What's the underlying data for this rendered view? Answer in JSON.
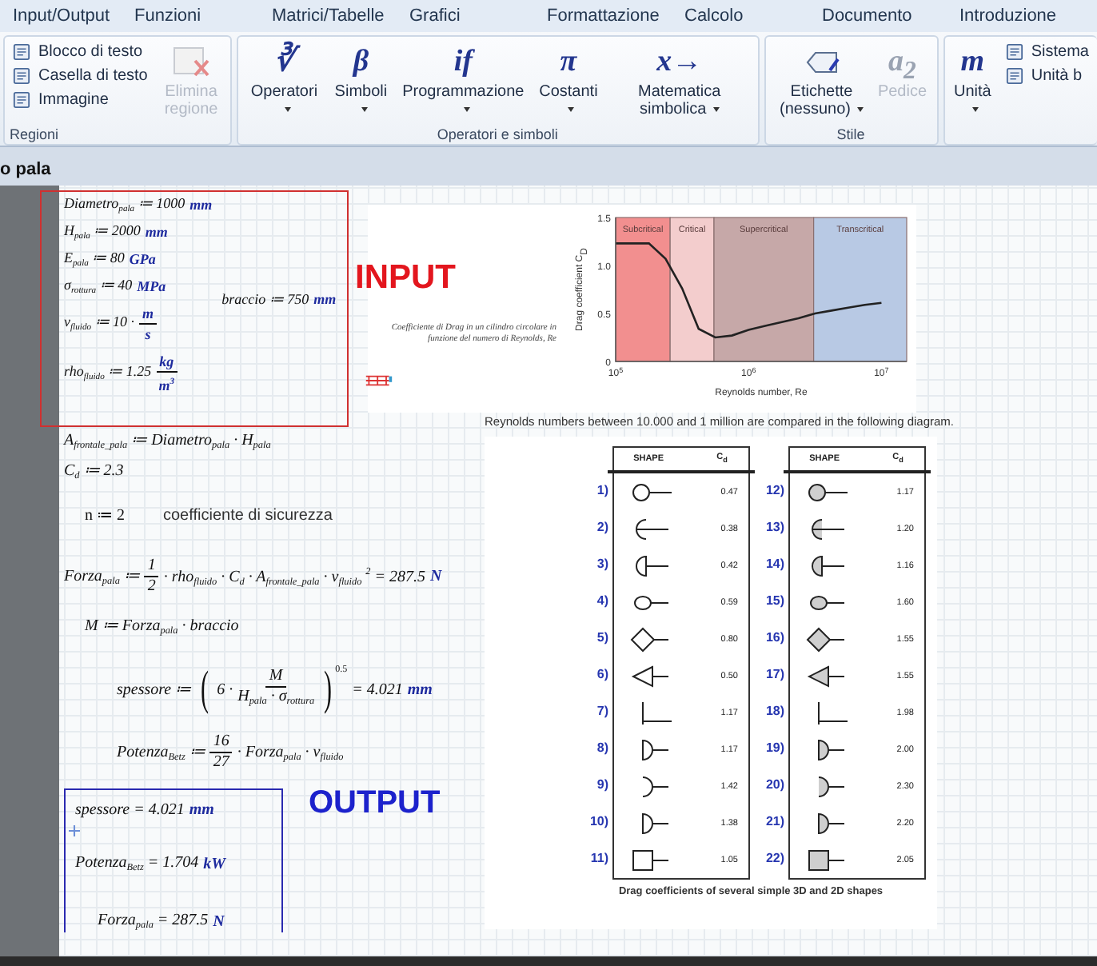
{
  "menu": [
    {
      "label": "Input/Output",
      "selected": false
    },
    {
      "label": "Funzioni",
      "selected": false
    },
    {
      "label": "Matrici/Tabelle",
      "selected": false
    },
    {
      "label": "Grafici",
      "selected": false
    },
    {
      "label": "Formattazione",
      "selected": false
    },
    {
      "label": "Calcolo",
      "selected": false
    },
    {
      "label": "Documento",
      "selected": false
    },
    {
      "label": "Introduzione",
      "selected": false
    }
  ],
  "ribbon": {
    "groups": [
      {
        "label": "Regioni",
        "buttons": [
          {
            "kind": "small",
            "label": "Blocco di testo",
            "disabled": false
          },
          {
            "kind": "small",
            "label": "Casella di testo",
            "disabled": false
          },
          {
            "kind": "small",
            "label": "Immagine",
            "disabled": false
          },
          {
            "kind": "big",
            "label": "Elimina regione",
            "disabled": true,
            "dropdown": false
          }
        ]
      },
      {
        "label": "Operatori e simboli",
        "buttons": [
          {
            "kind": "big",
            "glyph": "∛",
            "label": "Operatori",
            "disabled": false,
            "dropdown": true
          },
          {
            "kind": "big",
            "glyph": "β",
            "label": "Simboli",
            "disabled": false,
            "dropdown": true
          },
          {
            "kind": "big",
            "glyph": "if",
            "label": "Programmazione",
            "disabled": false,
            "dropdown": true
          },
          {
            "kind": "big",
            "glyph": "π",
            "label": "Costanti",
            "disabled": false,
            "dropdown": true
          },
          {
            "kind": "big",
            "glyph": "x→",
            "label": "Matematica simbolica",
            "disabled": false,
            "dropdown": true
          }
        ]
      },
      {
        "label": "Stile",
        "buttons": [
          {
            "kind": "big",
            "label": "Etichette (nessuno)",
            "disabled": false,
            "dropdown": true
          },
          {
            "kind": "big",
            "glyph": "a$_{2}$",
            "label": "Pedice",
            "disabled": true,
            "dropdown": false
          }
        ]
      },
      {
        "buttons": [
          {
            "kind": "big",
            "glyph": "m",
            "label": "Unità",
            "disabled": false,
            "dropdown": true
          },
          {
            "kind": "small",
            "label": "Sistema",
            "disabled": false
          },
          {
            "kind": "small",
            "label": "Unità b",
            "disabled": false
          }
        ]
      }
    ]
  },
  "tabs": [
    {
      "label": "o pala",
      "selected": true
    }
  ],
  "input_region": {
    "title": "INPUT",
    "expressions": [
      {
        "parts": [
          {
            "kind": "text",
            "text": "Diametro$_{pala}$ ≔ 1000"
          },
          {
            "kind": "unit",
            "text": "mm"
          }
        ]
      },
      {
        "parts": [
          {
            "kind": "text",
            "text": "H$_{pala}$ ≔ 2000"
          },
          {
            "kind": "unit",
            "text": "mm"
          }
        ]
      },
      {
        "parts": [
          {
            "kind": "text",
            "text": "E$_{pala}$ ≔ 80"
          },
          {
            "kind": "unit",
            "text": "GPa"
          }
        ]
      },
      {
        "parts": [
          {
            "kind": "text",
            "text": "σ$_{rottura}$ ≔ 40"
          },
          {
            "kind": "unit",
            "text": "MPa"
          }
        ]
      },
      {
        "parts": [
          {
            "kind": "text",
            "text": "v$_{fluido}$ ≔ 10 ·"
          },
          {
            "kind": "unit_frac",
            "num": "m",
            "den": "s"
          }
        ]
      },
      {
        "parts": [
          {
            "kind": "text",
            "text": "rho$_{fluido}$ ≔ 1.25"
          },
          {
            "kind": "unit_frac",
            "num": "kg",
            "den": "m$^{3}$"
          }
        ]
      }
    ],
    "side_expression": {
      "parts": [
        {
          "kind": "text",
          "text": "braccio ≔ 750"
        },
        {
          "kind": "unit",
          "text": "mm"
        }
      ]
    }
  },
  "chart_image": {
    "caption": "Coefficiente di Drag in un cilindro circolare in funzione del numero di Reynolds, Re",
    "regions": [
      {
        "label": "Subcritical",
        "color": "#f28f8f"
      },
      {
        "label": "Critical",
        "color": "#f3cdcd"
      },
      {
        "label": "Supercritical",
        "color": "#c6a8a8"
      },
      {
        "label": "Transcritical",
        "color": "#b8c9e4"
      }
    ],
    "chart_data": {
      "type": "line",
      "xlabel": "Reynolds number, Re",
      "ylabel": "Drag coefficient C$_{D}$",
      "categories": [
        "10$^{5}$",
        null,
        null,
        null,
        null,
        null,
        null,
        null,
        "10$^{6}$",
        null,
        null,
        null,
        null,
        null,
        null,
        null,
        "10$^{7}$"
      ],
      "series": [
        {
          "color": "#222222",
          "values": [
            1.23,
            1.23,
            1.23,
            1.07,
            0.76,
            0.34,
            0.25,
            0.27,
            0.33,
            0.37,
            0.41,
            0.45,
            0.5,
            0.53,
            0.56,
            0.59,
            0.61
          ]
        }
      ],
      "ylim": [
        0,
        1.5
      ],
      "yticks": [
        {
          "value": 0,
          "label": "0"
        },
        {
          "value": 0.5,
          "label": "0.5"
        },
        {
          "value": 1,
          "label": "1.0"
        },
        {
          "value": 1.5,
          "label": "1.5"
        }
      ]
    }
  },
  "expressions": [
    {
      "parts": [
        {
          "kind": "text",
          "text": "A$_{frontale_pala}$ ≔ Diametro$_{pala}$ · H$_{pala}$"
        }
      ]
    },
    {
      "parts": [
        {
          "kind": "text",
          "text": "C$_{d}$ ≔ 2.3"
        }
      ]
    },
    {
      "parts": [
        {
          "kind": "plain",
          "text": "n ≔ 2"
        }
      ],
      "comment": "coefficiente di sicurezza"
    },
    {
      "parts": [
        {
          "kind": "text",
          "text": "Forza$_{pala}$ ≔"
        },
        {
          "kind": "frac",
          "num": "1",
          "den": "2"
        },
        {
          "kind": "text",
          "text": "· rho$_{fluido}$ · C$_{d}$ · A$_{frontale_pala}$ · v$_{fluido}$ $^{2}$ = 287.5"
        },
        {
          "kind": "unit",
          "text": "N"
        }
      ]
    },
    {
      "parts": [
        {
          "kind": "text",
          "text": "M ≔ Forza$_{pala}$ · braccio"
        }
      ]
    },
    {
      "parts": [
        {
          "kind": "text",
          "text": "spessore ≔"
        },
        {
          "kind": "paren",
          "text": "("
        },
        {
          "kind": "text",
          "text": "6 ·"
        },
        {
          "kind": "frac",
          "num": "M",
          "den": "H$_{pala}$ · σ$_{rottura}$"
        },
        {
          "kind": "paren",
          "text": ")"
        },
        {
          "kind": "sup",
          "text": "0.5"
        },
        {
          "kind": "text",
          "text": "= 4.021"
        },
        {
          "kind": "unit",
          "text": "mm"
        }
      ]
    },
    {
      "parts": [
        {
          "kind": "text",
          "text": "Potenza$_{Betz}$ ≔"
        },
        {
          "kind": "frac",
          "num": "16",
          "den": "27"
        },
        {
          "kind": "text",
          "text": "· Forza$_{pala}$ · v$_{fluido}$"
        }
      ]
    }
  ],
  "output_region": {
    "title": "OUTPUT",
    "expressions": [
      {
        "parts": [
          {
            "kind": "text",
            "text": "spessore = 4.021"
          },
          {
            "kind": "unit",
            "text": "mm"
          }
        ]
      },
      {
        "parts": [
          {
            "kind": "text",
            "text": "Potenza$_{Betz}$ = 1.704"
          },
          {
            "kind": "unit",
            "text": "kW"
          }
        ]
      },
      {
        "parts": [
          {
            "kind": "text",
            "text": "Forza$_{pala}$ = 287.5"
          },
          {
            "kind": "unit",
            "text": "N"
          }
        ]
      }
    ]
  },
  "reynolds_text": "Reynolds numbers between 10.000 and 1 million are compared in the following diagram.",
  "shape_figure": {
    "caption": "Drag coefficients of several simple 3D and 2D shapes",
    "columns": [
      {
        "header_shape": "SHAPE",
        "header_cd": "C$_{d}$",
        "rows": [
          {
            "label": "1)",
            "cd": "0.47"
          },
          {
            "label": "2)",
            "cd": "0.38"
          },
          {
            "label": "3)",
            "cd": "0.42"
          },
          {
            "label": "4)",
            "cd": "0.59"
          },
          {
            "label": "5)",
            "cd": "0.80"
          },
          {
            "label": "6)",
            "cd": "0.50"
          },
          {
            "label": "7)",
            "cd": "1.17"
          },
          {
            "label": "8)",
            "cd": "1.17"
          },
          {
            "label": "9)",
            "cd": "1.42"
          },
          {
            "label": "10)",
            "cd": "1.38"
          },
          {
            "label": "11)",
            "cd": "1.05"
          }
        ]
      },
      {
        "header_shape": "SHAPE",
        "header_cd": "C$_{d}$",
        "rows": [
          {
            "label": "12)",
            "cd": "1.17"
          },
          {
            "label": "13)",
            "cd": "1.20"
          },
          {
            "label": "14)",
            "cd": "1.16"
          },
          {
            "label": "15)",
            "cd": "1.60"
          },
          {
            "label": "16)",
            "cd": "1.55"
          },
          {
            "label": "17)",
            "cd": "1.55"
          },
          {
            "label": "18)",
            "cd": "1.98"
          },
          {
            "label": "19)",
            "cd": "2.00"
          },
          {
            "label": "20)",
            "cd": "2.30"
          },
          {
            "label": "21)",
            "cd": "2.20"
          },
          {
            "label": "22)",
            "cd": "2.05"
          }
        ]
      }
    ]
  }
}
